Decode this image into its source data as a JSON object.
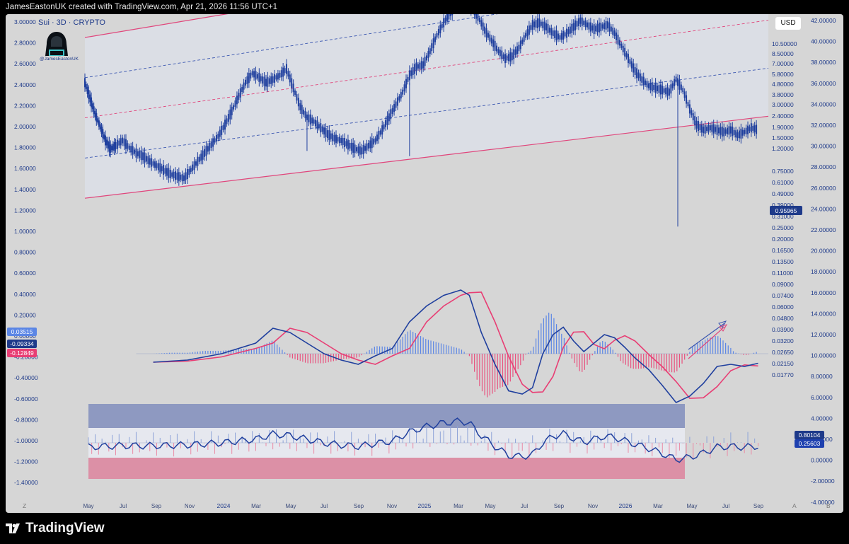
{
  "header": {
    "credit": "JamesEastonUK created with TradingView.com, Apr 21, 2026 11:56 UTC+1"
  },
  "footer": {
    "brand": "TradingView"
  },
  "chart_header": {
    "symbol": "Sui · 3D · CRYPTO",
    "avatar_label": "@JamesEastonUK",
    "currency_button": "USD"
  },
  "colors": {
    "background": "#d6d6d6",
    "candle": "#1f3f9e",
    "channel": "#e0457b",
    "channel_fill": "#dcdfe8",
    "macd": "#1f3f9e",
    "signal": "#e83e74",
    "hist_pos": "#5b86e5",
    "hist_neg": "#e8527f",
    "label_blue": "#1e40af",
    "label_red": "#e83e74"
  },
  "chart_data": {
    "type": "candlestick",
    "title": "Sui · 3D · CRYPTO",
    "x_labels": [
      "May",
      "Jul",
      "Sep",
      "Nov",
      "2024",
      "Mar",
      "May",
      "Jul",
      "Sep",
      "Nov",
      "2025",
      "Mar",
      "May",
      "Jul",
      "Sep",
      "Nov",
      "2026",
      "Mar",
      "May",
      "Jul",
      "Sep"
    ],
    "left_axis_ticks": [
      "3.00000",
      "2.80000",
      "2.60000",
      "2.40000",
      "2.20000",
      "2.00000",
      "1.80000",
      "1.60000",
      "1.40000",
      "1.20000",
      "1.00000",
      "0.80000",
      "0.60000",
      "0.40000",
      "0.20000",
      "0.00000",
      "-0.20000",
      "-0.40000",
      "-0.60000",
      "-0.80000",
      "-1.00000",
      "-1.20000",
      "-1.40000"
    ],
    "price_axis_ticks": [
      "10.50000",
      "8.50000",
      "7.00000",
      "5.80000",
      "4.80000",
      "3.80000",
      "3.00000",
      "2.40000",
      "1.90000",
      "1.50000",
      "1.20000",
      "0.95965",
      "0.75000",
      "0.61000",
      "0.49000",
      "0.39000",
      "0.31000",
      "0.25000",
      "0.20000",
      "0.16500",
      "0.13500",
      "0.11000",
      "0.09000",
      "0.07400",
      "0.06000",
      "0.04800",
      "0.03900",
      "0.03200",
      "0.02650",
      "0.02150",
      "0.01770"
    ],
    "right_axis_ticks": [
      "42.00000",
      "40.00000",
      "38.00000",
      "36.00000",
      "34.00000",
      "32.00000",
      "30.00000",
      "28.00000",
      "26.00000",
      "24.00000",
      "22.00000",
      "20.00000",
      "18.00000",
      "16.00000",
      "14.00000",
      "12.00000",
      "10.00000",
      "8.00000",
      "6.00000",
      "4.00000",
      "2.00000",
      "0.00000",
      "-2.00000",
      "-4.00000"
    ],
    "last_price": "0.95965",
    "macd_labels": {
      "histogram": "0.03515",
      "macd": "-0.09334",
      "signal": "-0.12849"
    },
    "oscillator_labels": {
      "upper": "0.80104",
      "lower": "0.25603"
    },
    "bottom_corner_labels": {
      "left": "Z",
      "right_a": "A",
      "right_b": "B"
    },
    "price_path": [
      [
        0,
        1.55
      ],
      [
        3,
        1.4
      ],
      [
        6,
        1.25
      ],
      [
        9,
        1.13
      ],
      [
        12,
        1.0
      ],
      [
        15,
        0.92
      ],
      [
        18,
        0.95
      ],
      [
        22,
        1.0
      ],
      [
        26,
        0.93
      ],
      [
        30,
        0.88
      ],
      [
        34,
        0.85
      ],
      [
        38,
        0.8
      ],
      [
        42,
        0.76
      ],
      [
        46,
        0.72
      ],
      [
        50,
        0.68
      ],
      [
        54,
        0.66
      ],
      [
        58,
        0.64
      ],
      [
        62,
        0.72
      ],
      [
        66,
        0.8
      ],
      [
        70,
        0.88
      ],
      [
        74,
        0.96
      ],
      [
        78,
        1.04
      ],
      [
        82,
        1.15
      ],
      [
        86,
        1.28
      ],
      [
        90,
        1.42
      ],
      [
        94,
        1.55
      ],
      [
        98,
        1.64
      ],
      [
        102,
        1.6
      ],
      [
        106,
        1.55
      ],
      [
        110,
        1.58
      ],
      [
        114,
        1.62
      ],
      [
        118,
        1.68
      ],
      [
        122,
        1.5
      ],
      [
        126,
        1.32
      ],
      [
        130,
        1.22
      ],
      [
        134,
        1.18
      ],
      [
        138,
        1.12
      ],
      [
        142,
        1.06
      ],
      [
        146,
        1.02
      ],
      [
        150,
        1.0
      ],
      [
        154,
        0.96
      ],
      [
        158,
        0.92
      ],
      [
        162,
        0.9
      ],
      [
        166,
        0.95
      ],
      [
        170,
        1.0
      ],
      [
        174,
        1.1
      ],
      [
        178,
        1.22
      ],
      [
        182,
        1.34
      ],
      [
        186,
        1.46
      ],
      [
        190,
        1.62
      ],
      [
        194,
        1.7
      ],
      [
        198,
        1.72
      ],
      [
        202,
        1.85
      ],
      [
        206,
        2.0
      ],
      [
        210,
        2.12
      ],
      [
        214,
        2.22
      ],
      [
        218,
        2.3
      ],
      [
        222,
        2.33
      ],
      [
        226,
        2.28
      ],
      [
        230,
        2.18
      ],
      [
        234,
        2.05
      ],
      [
        238,
        1.95
      ],
      [
        242,
        1.85
      ],
      [
        246,
        1.78
      ],
      [
        250,
        1.8
      ],
      [
        254,
        1.88
      ],
      [
        258,
        2.0
      ],
      [
        262,
        2.1
      ],
      [
        266,
        2.12
      ],
      [
        270,
        2.08
      ],
      [
        274,
        2.02
      ],
      [
        278,
        1.98
      ],
      [
        282,
        2.02
      ],
      [
        286,
        2.08
      ],
      [
        290,
        2.14
      ],
      [
        294,
        2.1
      ],
      [
        298,
        2.06
      ],
      [
        302,
        2.08
      ],
      [
        306,
        2.1
      ],
      [
        310,
        2.02
      ],
      [
        314,
        1.9
      ],
      [
        318,
        1.78
      ],
      [
        322,
        1.66
      ],
      [
        326,
        1.58
      ],
      [
        330,
        1.52
      ],
      [
        334,
        1.5
      ],
      [
        338,
        1.48
      ],
      [
        342,
        1.46
      ],
      [
        346,
        1.58
      ],
      [
        350,
        1.48
      ],
      [
        354,
        1.3
      ],
      [
        358,
        1.15
      ],
      [
        362,
        1.1
      ],
      [
        366,
        1.12
      ],
      [
        370,
        1.1
      ],
      [
        374,
        1.08
      ],
      [
        378,
        1.1
      ],
      [
        382,
        1.05
      ],
      [
        386,
        1.08
      ],
      [
        390,
        1.12
      ],
      [
        394,
        1.1
      ]
    ],
    "channel": {
      "upper": [
        [
          0,
          1.98
        ],
        [
          400,
          3.06
        ]
      ],
      "lower": [
        [
          0,
          0.45
        ],
        [
          400,
          1.23
        ]
      ]
    },
    "macd_series": [
      [
        0,
        -0.12
      ],
      [
        20,
        -0.08
      ],
      [
        40,
        -0.08
      ],
      [
        60,
        -0.06
      ],
      [
        80,
        0.0
      ],
      [
        100,
        0.1
      ],
      [
        110,
        0.24
      ],
      [
        120,
        0.2
      ],
      [
        130,
        0.1
      ],
      [
        140,
        0.0
      ],
      [
        150,
        -0.06
      ],
      [
        160,
        -0.1
      ],
      [
        170,
        -0.02
      ],
      [
        180,
        0.05
      ],
      [
        190,
        0.3
      ],
      [
        200,
        0.45
      ],
      [
        210,
        0.55
      ],
      [
        220,
        0.6
      ],
      [
        225,
        0.55
      ],
      [
        232,
        0.2
      ],
      [
        240,
        -0.1
      ],
      [
        248,
        -0.35
      ],
      [
        256,
        -0.38
      ],
      [
        262,
        -0.32
      ],
      [
        268,
        0.0
      ],
      [
        274,
        0.18
      ],
      [
        280,
        0.25
      ],
      [
        286,
        0.12
      ],
      [
        292,
        0.02
      ],
      [
        298,
        0.1
      ],
      [
        304,
        0.18
      ],
      [
        310,
        0.15
      ],
      [
        316,
        0.06
      ],
      [
        322,
        -0.04
      ],
      [
        330,
        -0.15
      ],
      [
        338,
        -0.3
      ],
      [
        346,
        -0.46
      ],
      [
        354,
        -0.4
      ],
      [
        362,
        -0.28
      ],
      [
        370,
        -0.12
      ],
      [
        378,
        -0.1
      ],
      [
        386,
        -0.12
      ],
      [
        394,
        -0.09
      ]
    ]
  }
}
